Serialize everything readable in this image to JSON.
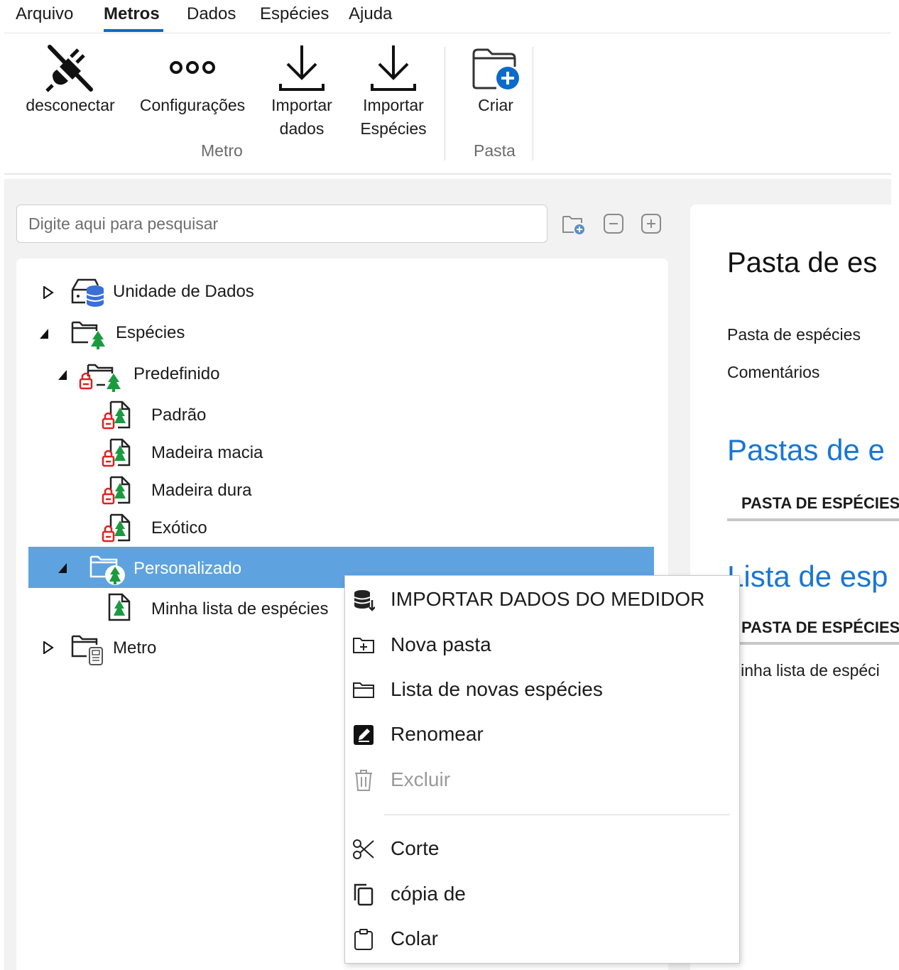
{
  "menu": {
    "items": [
      {
        "label": "Arquivo"
      },
      {
        "label": "Metros",
        "active": true
      },
      {
        "label": "Dados"
      },
      {
        "label": "Espécies"
      },
      {
        "label": "Ajuda"
      }
    ]
  },
  "ribbon": {
    "disconnect": {
      "label": "desconectar",
      "icon": "plug-disconnect-icon"
    },
    "settings": {
      "label": "Configurações",
      "icon": "more-dots-icon"
    },
    "import_data": {
      "line1": "Importar",
      "line2": "dados",
      "icon": "download-icon"
    },
    "import_species": {
      "line1": "Importar",
      "line2": "Espécies",
      "icon": "download-icon"
    },
    "group_metro": "Metro",
    "create": {
      "label": "Criar",
      "icon": "folder-add-icon"
    },
    "group_pasta": "Pasta"
  },
  "search": {
    "placeholder": "Digite aqui para pesquisar"
  },
  "tree": {
    "data_unit": "Unidade de Dados",
    "species": "Espécies",
    "predefined": "Predefinido",
    "standard": "Padrão",
    "softwood": "Madeira macia",
    "hardwood": "Madeira dura",
    "exotic": "Exótico",
    "custom": "Personalizado",
    "my_list": "Minha lista de espécies",
    "meter": "Metro"
  },
  "right_panel": {
    "title": "Pasta de es",
    "field_folder": "Pasta de espécies",
    "field_comments": "Comentários",
    "section_folders": "Pastas de e",
    "col_folders": "PASTA DE ESPÉCIES",
    "section_lists": "Lista de esp",
    "col_lists": "PASTA DE ESPÉCIES",
    "row_list": "Minha lista de espéci"
  },
  "context_menu": {
    "import_meter": "IMPORTAR DADOS DO MEDIDOR",
    "new_folder": "Nova pasta",
    "new_species_list": "Lista de novas espécies",
    "rename": "Renomear",
    "delete": "Excluir",
    "cut": "Corte",
    "copy": "cópia de",
    "paste": "Colar"
  },
  "colors": {
    "accent": "#0a6bc9",
    "selection": "#5ea3e0",
    "heading_blue": "#1976d2",
    "tree_green": "#1a9b3f",
    "lock_red": "#e02020"
  }
}
